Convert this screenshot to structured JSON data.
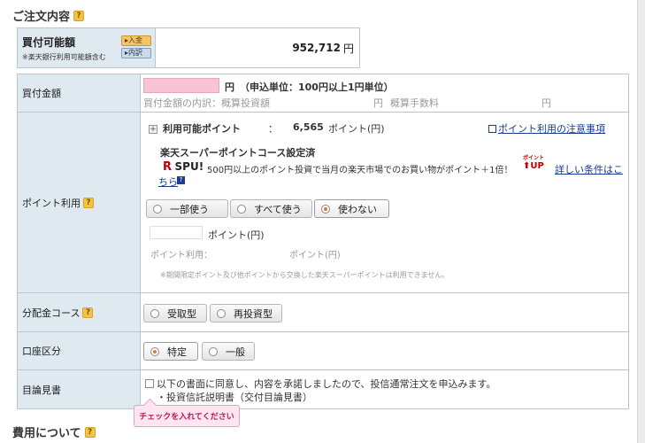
{
  "order_section": {
    "title": "ご注文内容",
    "help": "?"
  },
  "buying_power": {
    "label": "買付可能額",
    "sublabel": "※楽天銀行利用可能額含む",
    "deposit_btn": "▸入金",
    "detail_btn": "▸内訳",
    "value": "952,712",
    "unit": "円"
  },
  "amount": {
    "label": "買付金額",
    "unit": "円",
    "note": "（申込単位：100円以上1円単位）",
    "breakdown_label": "買付金額の内訳：概算投資額",
    "breakdown_unit1": "円",
    "fee_label": "概算手数料",
    "breakdown_unit2": "円"
  },
  "points": {
    "label": "ポイント利用",
    "help": "?",
    "available_label": "利用可能ポイント",
    "colon": "：",
    "available_value": "6,565",
    "available_unit": "ポイント(円)",
    "notice_link": "ポイント利用の注意事項",
    "course_status": "楽天スーパーポイントコース設定済",
    "spu_r": "R",
    "spu_text": "SPU!",
    "spu_desc": "500円以上のポイント投資で当月の楽天市場でのお買い物がポイント＋1倍！",
    "up_small": "ポイント",
    "up_text": "⬆UP",
    "details_link_a": "詳しい条件はこ",
    "details_link_b": "ちら",
    "options": [
      "一部使う",
      "すべて使う",
      "使わない"
    ],
    "input_unit": "ポイント(円)",
    "use_label": "ポイント利用：",
    "use_unit": "ポイント(円)",
    "disclaimer": "※期間限定ポイント及び他ポイントから交換した楽天スーパーポイントは利用できません。"
  },
  "distribution": {
    "label": "分配金コース",
    "help": "?",
    "options": [
      "受取型",
      "再投資型"
    ]
  },
  "account": {
    "label": "口座区分",
    "options": [
      "特定",
      "一般"
    ]
  },
  "prospectus": {
    "label": "目論見書",
    "agree_text": "以下の書面に同意し、内容を承諾しましたので、投信通常注文を申込みます。",
    "doc_item": "・投資信託説明書（交付目論見書）",
    "tooltip": "チェックを入れてください"
  },
  "fees_section": {
    "title": "費用について",
    "help": "?"
  },
  "colors": {
    "label_bg": "#dfe9f0",
    "accent_pink": "#f7c4d6",
    "rakuten_red": "#bf0000",
    "link_blue": "#1a3d8f"
  }
}
